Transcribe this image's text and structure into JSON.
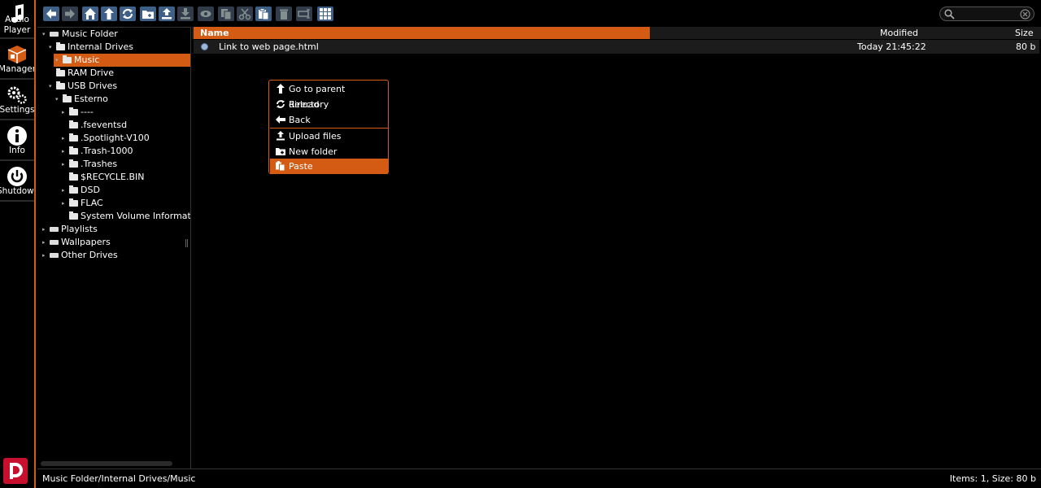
{
  "nav": {
    "items": [
      {
        "label": "Audio\nPlayer",
        "l1": "Audio",
        "l2": "Player",
        "icon": "music-note-icon"
      },
      {
        "label": "Manager",
        "icon": "box-icon"
      },
      {
        "label": "Settings",
        "icon": "gears-icon"
      },
      {
        "label": "Info",
        "icon": "info-icon"
      },
      {
        "label": "Shutdown",
        "icon": "power-icon"
      }
    ],
    "active": "Manager",
    "accent": "#d35b14"
  },
  "toolbar": {
    "buttons": [
      {
        "name": "back",
        "icon": "arrow-left-icon",
        "enabled": true
      },
      {
        "name": "forward",
        "icon": "arrow-right-icon",
        "enabled": false
      },
      {
        "name": "home",
        "icon": "home-icon",
        "enabled": true
      },
      {
        "name": "parent",
        "icon": "arrow-up-icon",
        "enabled": true
      },
      {
        "name": "reload",
        "icon": "reload-icon",
        "enabled": true
      },
      {
        "name": "new-folder",
        "icon": "new-folder-icon",
        "enabled": true
      },
      {
        "name": "upload",
        "icon": "upload-icon",
        "enabled": true
      },
      {
        "name": "download",
        "icon": "download-icon",
        "enabled": false
      },
      {
        "name": "view",
        "icon": "eye-icon",
        "enabled": false
      },
      {
        "name": "copy",
        "icon": "copy-icon",
        "enabled": false
      },
      {
        "name": "cut",
        "icon": "cut-icon",
        "enabled": false
      },
      {
        "name": "paste",
        "icon": "paste-icon",
        "enabled": true
      },
      {
        "name": "delete",
        "icon": "trash-icon",
        "enabled": false
      },
      {
        "name": "rename",
        "icon": "rename-icon",
        "enabled": false
      },
      {
        "name": "view-mode",
        "icon": "grid-icon",
        "enabled": true
      }
    ],
    "search": {
      "placeholder": "",
      "value": ""
    }
  },
  "tree": {
    "nodes": [
      {
        "label": "Music Folder",
        "expanded": true
      },
      {
        "label": "Internal Drives",
        "expanded": true
      },
      {
        "label": "Music",
        "selected": true
      },
      {
        "label": "RAM Drive"
      },
      {
        "label": "USB Drives",
        "expanded": true
      },
      {
        "label": "Esterno",
        "expanded": true
      },
      {
        "label": "----"
      },
      {
        "label": ".fseventsd"
      },
      {
        "label": ".Spotlight-V100"
      },
      {
        "label": ".Trash-1000"
      },
      {
        "label": ".Trashes"
      },
      {
        "label": "$RECYCLE.BIN"
      },
      {
        "label": "DSD"
      },
      {
        "label": "FLAC"
      },
      {
        "label": "System Volume Information"
      },
      {
        "label": "Playlists"
      },
      {
        "label": "Wallpapers"
      },
      {
        "label": "Other Drives"
      }
    ]
  },
  "filelist": {
    "columns": {
      "name": "Name",
      "modified": "Modified",
      "size": "Size"
    },
    "rows": [
      {
        "name": "Link to web page.html",
        "modified": "Today 21:45:22",
        "size": "80 b",
        "icon": "web-link-icon"
      }
    ]
  },
  "context_menu": {
    "items": [
      {
        "label": "Go to parent directory",
        "icon": "arrow-up-icon"
      },
      {
        "label": "Reload",
        "icon": "reload-icon"
      },
      {
        "label": "Back",
        "icon": "arrow-left-icon"
      },
      {
        "label": "Upload files",
        "icon": "upload-icon"
      },
      {
        "label": "New folder",
        "icon": "new-folder-icon"
      },
      {
        "label": "Paste",
        "icon": "paste-icon",
        "highlighted": true
      }
    ]
  },
  "statusbar": {
    "path": "Music Folder/Internal Drives/Music",
    "info": "Items: 1, Size: 80 b"
  }
}
